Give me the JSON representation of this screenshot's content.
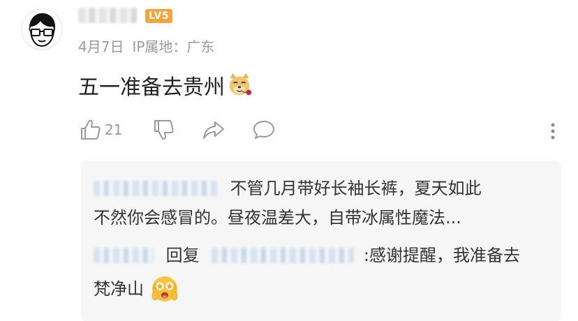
{
  "comment": {
    "level_badge": "LV5",
    "date": "4月7日",
    "ip_location": "IP属地：广东",
    "text": "五一准备去贵州",
    "text_emoji": "doge-rose-emoji"
  },
  "actions": {
    "like_count": "21",
    "icons": [
      "thumbs-up-icon",
      "thumbs-down-icon",
      "share-icon",
      "comment-icon",
      "more-icon"
    ]
  },
  "replies": [
    {
      "text_line1": "不管几月带好长袖长裤，夏天如此",
      "text_line2": "不然你会感冒的。昼夜温差大，自带冰属性魔法..."
    },
    {
      "reply_word": "回复",
      "text_line1": ":感谢提醒，我准备去",
      "text_line2": "梵净山",
      "emoji": "excited-face-emoji"
    }
  ],
  "colors": {
    "badge": "#f6a33b",
    "meta_text": "#9a9a9a",
    "reply_bg": "#f6f6f6"
  }
}
